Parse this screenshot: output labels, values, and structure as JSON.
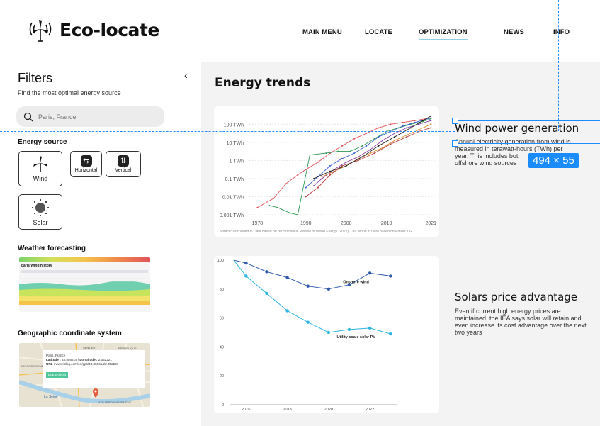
{
  "header": {
    "app_title": "Eco-locate",
    "nav": [
      "MAIN MENU",
      "LOCATE",
      "OPTIMIZATION",
      "NEWS",
      "INFO"
    ],
    "active": "OPTIMIZATION"
  },
  "sidebar": {
    "title": "Filters",
    "subtitle": "Find the most optimal energy source",
    "search_placeholder": "Paris, France",
    "energy_source_title": "Energy source",
    "wind_label": "Wind",
    "horizontal_label": "Horizontal",
    "vertical_label": "Vertical",
    "solar_label": "Solar",
    "weather_title": "Weather forecasting",
    "weather_thumb_title": "paris Wind history",
    "geo_title": "Geographic coordinate system",
    "map": {
      "place": "Paris, France",
      "lat_label": "Latitude :",
      "lat": "48.856614",
      "lng_label": "Longitude :",
      "lng": "2.352221",
      "url_label": "URL :",
      "url": "www.itilog.com/en/gps/48.856614/2.352221",
      "elevation": "ELEVATION",
      "district1": "SENTIER",
      "district2": "RÉPUBLIQUE",
      "river": "La Seine",
      "arr": "4TH ARRONDISSEMENT",
      "arr2": "ARRONDISSEMENT"
    }
  },
  "main": {
    "title": "Energy trends"
  },
  "wind_section": {
    "title": "Wind power generation",
    "desc_lines": [
      "Annual electricity generation from wind is",
      "measured in terawatt-hours (TWh) per",
      "year. This includes both",
      "offshore wind sources"
    ]
  },
  "solar_section": {
    "title": "Solars price advantage",
    "desc_lines": [
      "Even if current high energy prices are",
      "maintained, the IEA says solar will retain and",
      "even increase its cost advantage over the next",
      "two years"
    ]
  },
  "overlay": {
    "dimension": "494 × 55"
  },
  "chart_data": [
    {
      "type": "line",
      "scale": "log",
      "y_ticks": [
        {
          "v": -3,
          "label": "0.001 TWh"
        },
        {
          "v": -2,
          "label": "0.01 TWh"
        },
        {
          "v": -1,
          "label": "0.1 TWh"
        },
        {
          "v": 0,
          "label": "1 TWh"
        },
        {
          "v": 1,
          "label": "10 TWh"
        },
        {
          "v": 2,
          "label": "100 TWh"
        }
      ],
      "x_ticks": [
        1978,
        1990,
        2000,
        2010,
        2021
      ],
      "xlim": [
        1976,
        2022
      ],
      "ylim": [
        -3.2,
        2.6
      ],
      "source": "Source: Our World in Data based on BP Statistical Review of World Energy (2022); Our World in Data based on Ember's G",
      "series": [
        {
          "color": "#e0525a",
          "x": [
            1978,
            1982,
            1985,
            1988,
            1990,
            1993,
            1996,
            1999,
            2002,
            2005,
            2008,
            2011,
            2014,
            2017,
            2021
          ],
          "y": [
            -2.6,
            -2.1,
            -1.3,
            -0.8,
            -0.5,
            -0.1,
            0.4,
            0.8,
            1.2,
            1.5,
            1.8,
            2.0,
            2.1,
            2.2,
            2.35
          ]
        },
        {
          "color": "#2f9a55",
          "x": [
            1981,
            1983,
            1986,
            1988,
            1991,
            1995,
            1998,
            2001,
            2004,
            2007,
            2010,
            2013,
            2016,
            2019,
            2021
          ],
          "y": [
            -2.5,
            -2.6,
            -2.9,
            -3.0,
            0.3,
            0.4,
            0.5,
            0.5,
            0.8,
            1.2,
            1.6,
            1.8,
            2.0,
            2.15,
            2.3
          ]
        },
        {
          "color": "#3a5fcd",
          "x": [
            1990,
            1993,
            1996,
            1999,
            2002,
            2005,
            2008,
            2011,
            2014,
            2017,
            2021
          ],
          "y": [
            -1.5,
            -0.9,
            -0.3,
            0.1,
            0.4,
            0.8,
            1.3,
            1.6,
            1.9,
            2.1,
            2.35
          ]
        },
        {
          "color": "#8a3fa8",
          "x": [
            1992,
            1994,
            1997,
            2000,
            2003,
            2006,
            2009,
            2012,
            2015,
            2018,
            2021
          ],
          "y": [
            -1.4,
            -1.0,
            -0.5,
            -0.1,
            0.2,
            0.6,
            1.1,
            1.5,
            1.8,
            2.0,
            2.2
          ]
        },
        {
          "color": "#d98a27",
          "x": [
            1994,
            1997,
            2000,
            2003,
            2006,
            2009,
            2012,
            2015,
            2018,
            2021
          ],
          "y": [
            -0.9,
            -0.6,
            -0.3,
            0.1,
            0.4,
            0.7,
            1.1,
            1.4,
            1.7,
            2.0
          ]
        },
        {
          "color": "#b83c3c",
          "x": [
            1990,
            1993,
            1996,
            1999,
            2003,
            2007,
            2011,
            2015,
            2018,
            2021
          ],
          "y": [
            -2.0,
            -1.5,
            -0.8,
            -0.3,
            0.0,
            0.4,
            0.9,
            1.3,
            1.6,
            1.8
          ]
        },
        {
          "color": "#222222",
          "x": [
            1992,
            1996,
            2000,
            2004,
            2008,
            2012,
            2016,
            2019,
            2021
          ],
          "y": [
            -1.0,
            -0.6,
            -0.3,
            0.2,
            0.8,
            1.3,
            1.8,
            2.2,
            2.45
          ]
        }
      ]
    },
    {
      "type": "line",
      "y_ticks": [
        0,
        20,
        40,
        60,
        80,
        100
      ],
      "x_ticks": [
        2016,
        2018,
        2020,
        2022
      ],
      "xlim": [
        2015.2,
        2023.3
      ],
      "ylim": [
        0,
        100
      ],
      "series": [
        {
          "name": "Onshore wind",
          "color": "#2e5aac",
          "x": [
            2015.4,
            2016,
            2017,
            2018,
            2019,
            2020,
            2021,
            2022,
            2023
          ],
          "y": [
            100,
            98,
            92,
            88,
            82,
            80,
            83,
            91,
            89
          ]
        },
        {
          "name": "Utility-scale solar PV",
          "color": "#2bb5e0",
          "x": [
            2015.4,
            2016,
            2017,
            2018,
            2019,
            2020,
            2021,
            2022,
            2023
          ],
          "y": [
            100,
            89,
            77,
            65,
            57,
            50,
            52,
            53,
            49
          ]
        }
      ]
    }
  ]
}
